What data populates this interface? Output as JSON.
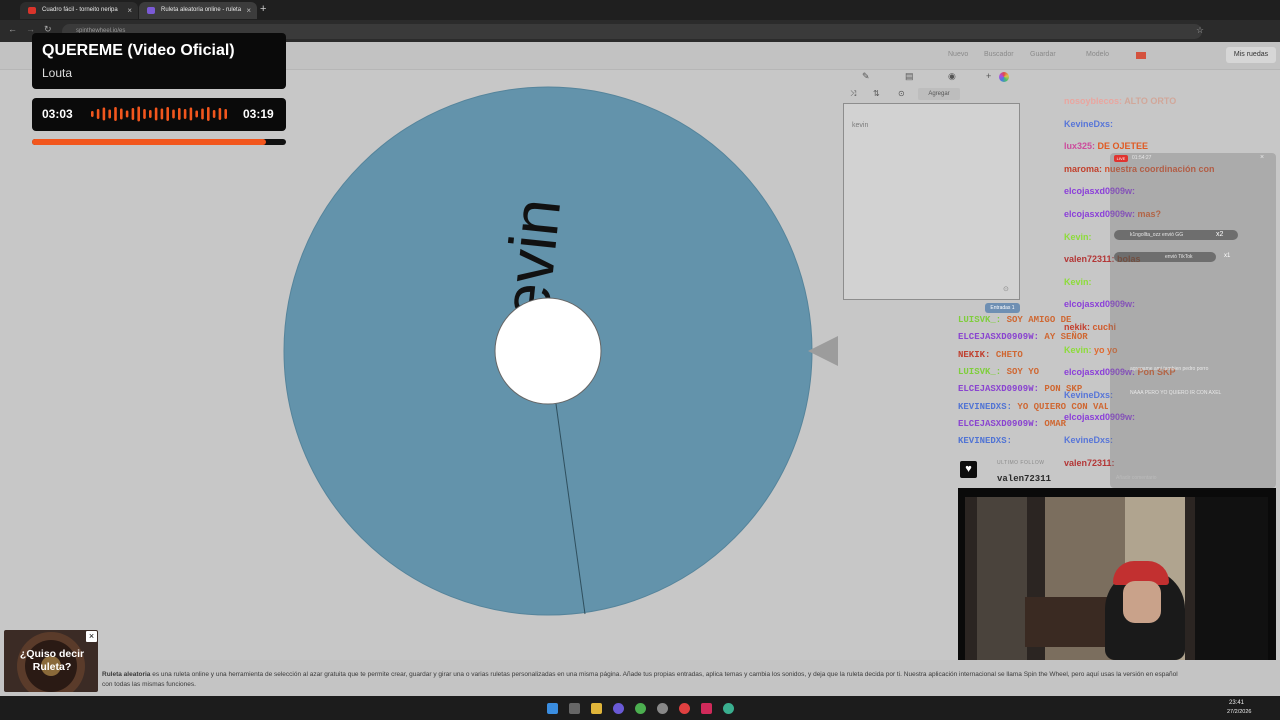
{
  "browser": {
    "tabs": [
      {
        "label": "Cuadro fácil - torneito neripa",
        "color": "#d9342b"
      },
      {
        "label": "Ruleta aleatoria online - ruleta",
        "color": "#7b5ad6"
      }
    ],
    "new_tab": "+",
    "url": "spinthewheel.io/es"
  },
  "site": {
    "nav": [
      "Nuevo",
      "Buscador",
      "Guardar",
      "Modelo"
    ],
    "my_wheels": "Mis ruedas"
  },
  "wheel": {
    "entries": [
      "kevin"
    ],
    "color": "#6393ab"
  },
  "editor": {
    "add_label": "Agregar",
    "entries_text": "kevin",
    "badge": "Entradas 1"
  },
  "now_playing": {
    "title": "QUEREME (Video Oficial)",
    "artist": "Louta",
    "current": "03:03",
    "duration": "03:19",
    "progress": 0.92,
    "accent": "#f2561d"
  },
  "chat": [
    {
      "user": "nosoyblecos:",
      "msg": "ALTO ORTO",
      "user_color": "#e9a6a0",
      "msg_color": "#d1a79a"
    },
    {
      "user": "KevineDxs:",
      "msg": "",
      "user_color": "#5876d8",
      "msg_color": "#e9e9e9"
    },
    {
      "user": "lux325:",
      "msg": "DE OJETEE",
      "user_color": "#cc4b9c",
      "msg_color": "#e05a22"
    },
    {
      "user": "maroma:",
      "msg": "nuestra coordinación con",
      "user_color": "#c2412d",
      "msg_color": "#d1502c"
    },
    {
      "user": "elcojasxd0909w:",
      "msg": "",
      "user_color": "#8b3fd9",
      "msg_color": "#d15b2c"
    },
    {
      "user": "elcojasxd0909w:",
      "msg": "mas?",
      "user_color": "#8b3fd9",
      "msg_color": "#d15b2c"
    },
    {
      "user": "Kevin:",
      "msg": "",
      "user_color": "#8ddc3a",
      "msg_color": "#e06a30"
    },
    {
      "user": "valen72311:",
      "msg": "bolas",
      "user_color": "#b33636",
      "msg_color": "#d15b2c"
    },
    {
      "user": "Kevin:",
      "msg": "",
      "user_color": "#8ddc3a",
      "msg_color": "#e06a30"
    },
    {
      "user": "elcojasxd0909w:",
      "msg": "",
      "user_color": "#8b3fd9",
      "msg_color": "#d15b2c"
    },
    {
      "user": "nekik:",
      "msg": "cuchi",
      "user_color": "#c3402f",
      "msg_color": "#d15b2c"
    },
    {
      "user": "Kevin:",
      "msg": "yo yo",
      "user_color": "#8ddc3a",
      "msg_color": "#e06a30"
    },
    {
      "user": "elcojasxd0909w:",
      "msg": "Pon SKP",
      "user_color": "#8b3fd9",
      "msg_color": "#d15b2c"
    },
    {
      "user": "KevineDxs:",
      "msg": "",
      "user_color": "#5876d8",
      "msg_color": "#d15b2c"
    },
    {
      "user": "elcojasxd0909w:",
      "msg": "",
      "user_color": "#8b3fd9",
      "msg_color": "#d15b2c"
    },
    {
      "user": "KevineDxs:",
      "msg": "",
      "user_color": "#5876d8",
      "msg_color": "#d15b2c"
    },
    {
      "user": "valen72311:",
      "msg": "",
      "user_color": "#b33636",
      "msg_color": "#d15b2c"
    }
  ],
  "chat2": [
    {
      "user": "LUISVK_:",
      "msg": "SOY AMIGO DE",
      "user_color": "#7fce3c",
      "msg_color": "#cf6833"
    },
    {
      "user": "ELCEJASXD0909W:",
      "msg": "AY SEÑOR",
      "user_color": "#8a44d0",
      "msg_color": "#cf6833"
    },
    {
      "user": "NEKIK:",
      "msg": "CHETO",
      "user_color": "#c0402f",
      "msg_color": "#cf6833"
    },
    {
      "user": "LUISVK_:",
      "msg": "SOY YO",
      "user_color": "#7fce3c",
      "msg_color": "#cf6833"
    },
    {
      "user": "ELCEJASXD0909W:",
      "msg": "PON SKP",
      "user_color": "#8a44d0",
      "msg_color": "#cf6833"
    },
    {
      "user": "KEVINEDXS:",
      "msg": "YO QUIERO CON VALEN",
      "user_color": "#5174d4",
      "msg_color": "#cf6833"
    },
    {
      "user": "ELCEJASXD0909W:",
      "msg": "OMAR",
      "user_color": "#8a44d0",
      "msg_color": "#cf6833"
    },
    {
      "user": "KEVINEDXS:",
      "msg": "",
      "user_color": "#5174d4",
      "msg_color": "#cf6833"
    }
  ],
  "follow": {
    "label": "ULTIMO FOLLOW",
    "name": "valen72311"
  },
  "popup": {
    "timer": "01:54:27",
    "notif1": "k1ngollta_ozz envió GG",
    "notif1_count": "x2",
    "notif2": "envió TikTok",
    "notif2_count": "x1",
    "comment1": "agregame ami tambien pedro porro",
    "comment2": "NAAA PERO YO QUIERO IR CON AXEL",
    "add_comment": "Añadir comentario"
  },
  "ad": {
    "text": "¿Quiso decir Ruleta?"
  },
  "info": {
    "bold": "Ruleta aleatoria",
    "text": " es una ruleta online y una herramienta de selección al azar gratuita que te permite crear, guardar y girar una o varias ruletas personalizadas en una misma página. Añade tus propias entradas, aplica temas y cambia los sonidos, y deja que la ruleta decida por ti. Nuestra aplicación internacional se llama Spin the Wheel, pero aquí usas la versión en español con todas las mismas funciones."
  },
  "taskbar": {
    "time": "23:41",
    "date": "27/2/2026"
  }
}
